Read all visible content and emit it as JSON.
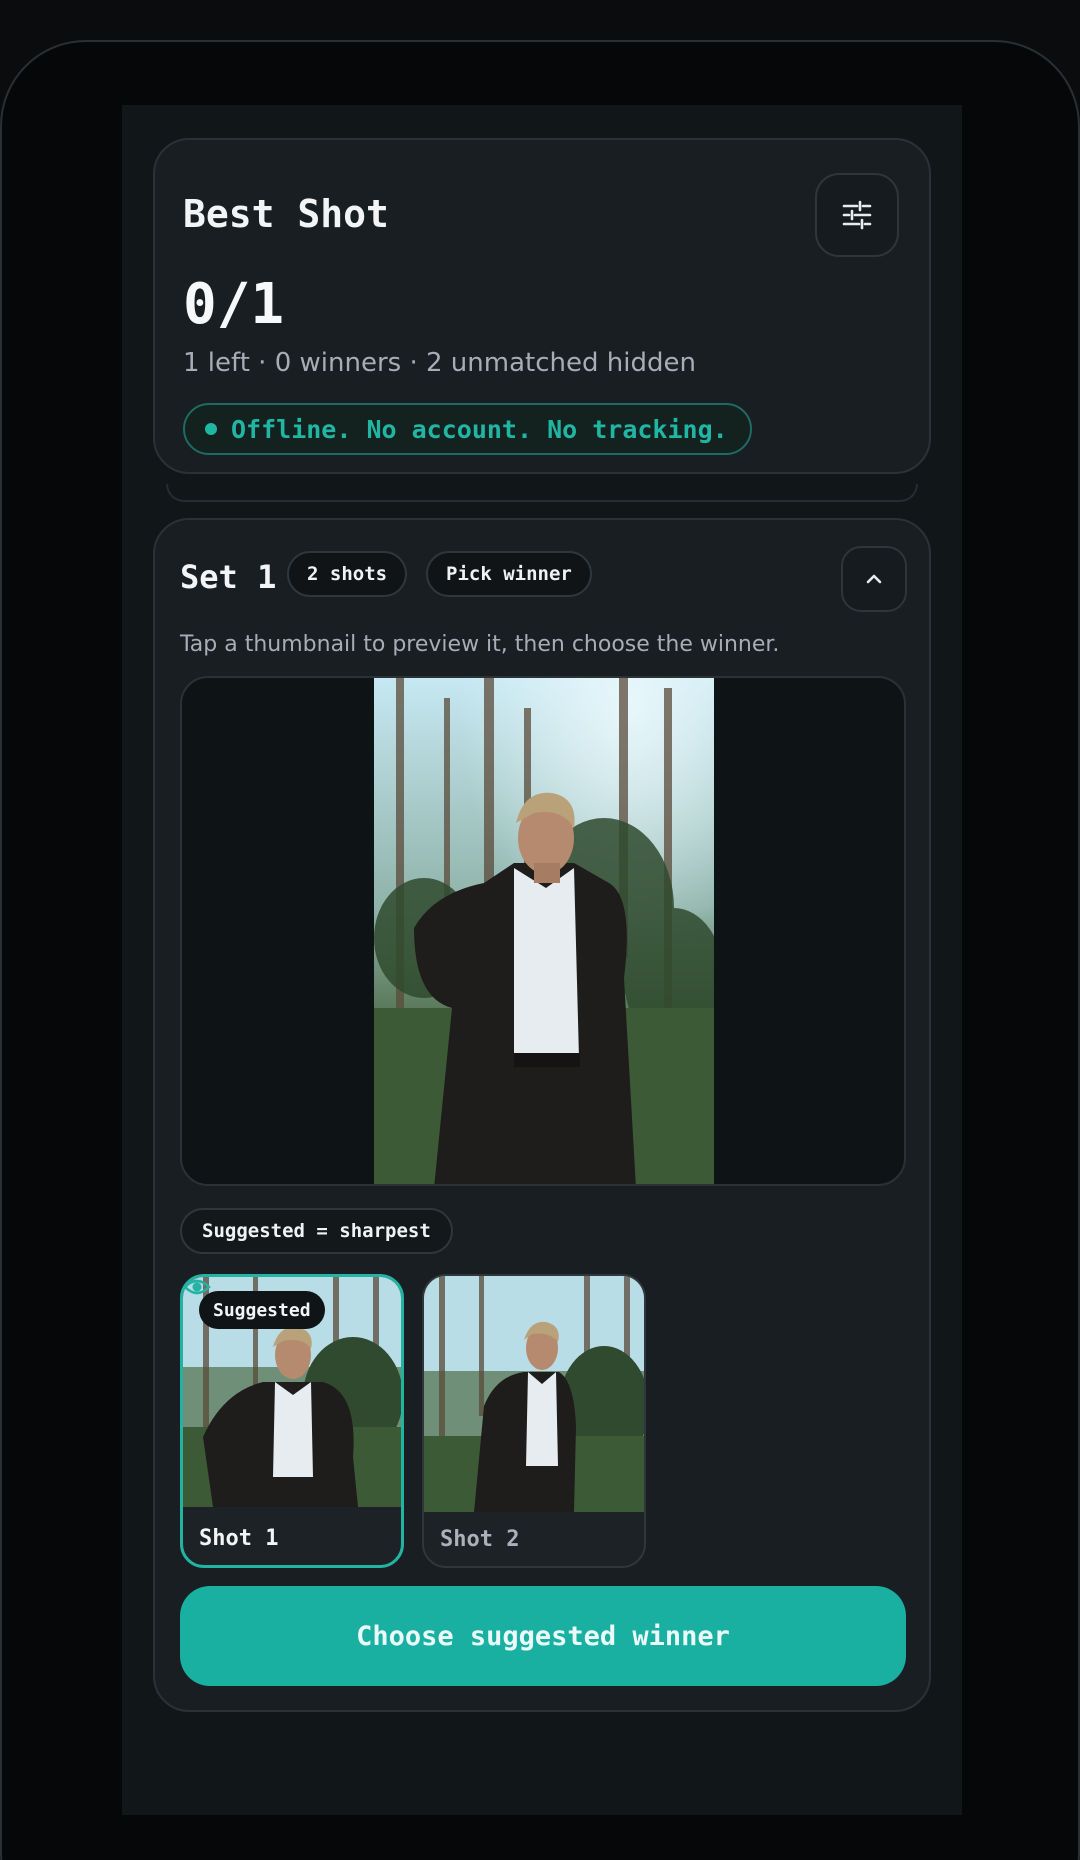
{
  "header": {
    "title": "Best Shot",
    "settings_icon": "sliders-icon",
    "progress": "0/1",
    "detail": "1 left · 0 winners · 2 unmatched hidden",
    "offline_badge": "Offline. No account. No tracking."
  },
  "set": {
    "title": "Set 1",
    "shots_chip": "2 shots",
    "status_chip": "Pick winner",
    "collapse_icon": "chevron-up-icon",
    "instruction": "Tap a thumbnail to preview it, then choose the winner.",
    "suggest_rule": "Suggested = sharpest",
    "thumbnails": [
      {
        "label": "Shot 1",
        "badge": "Suggested",
        "selected": true,
        "icon": "eye-icon"
      },
      {
        "label": "Shot 2",
        "selected": false
      }
    ],
    "cta": "Choose suggested winner"
  },
  "colors": {
    "accent": "#19b0a2",
    "background": "#111619",
    "card": "#181e22"
  }
}
